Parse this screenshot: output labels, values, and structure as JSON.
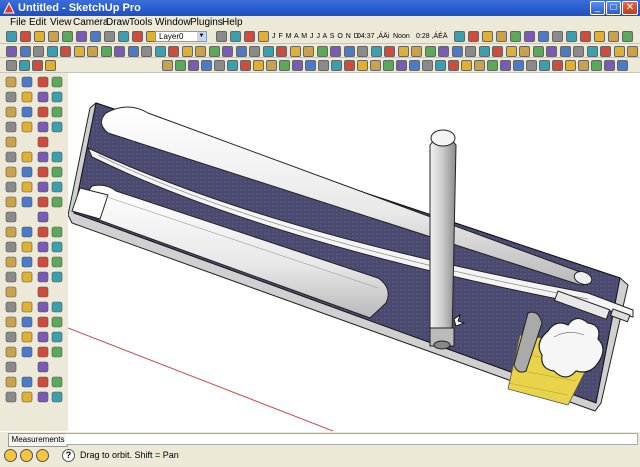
{
  "window": {
    "title": "Untitled - SketchUp Pro"
  },
  "menu": [
    "File",
    "Edit",
    "View",
    "Camera",
    "Draw",
    "Tools",
    "Window",
    "Plugins",
    "Help"
  ],
  "layer": {
    "value": "Layer0"
  },
  "shadow": {
    "months": "J F M A M J J A S O N D",
    "time_a": "04:37 ,ÁÄi",
    "noon": "Noon",
    "time_b": "0:28 ,ÁÉÄ"
  },
  "measurements": {
    "label": "Measurements",
    "value": ""
  },
  "status": {
    "hint": "Drag to orbit.  Shift = Pan"
  },
  "colors": {
    "base": "#45446a",
    "accent_paper": "#e8d34a",
    "titlebar": "#2a5fd0"
  }
}
